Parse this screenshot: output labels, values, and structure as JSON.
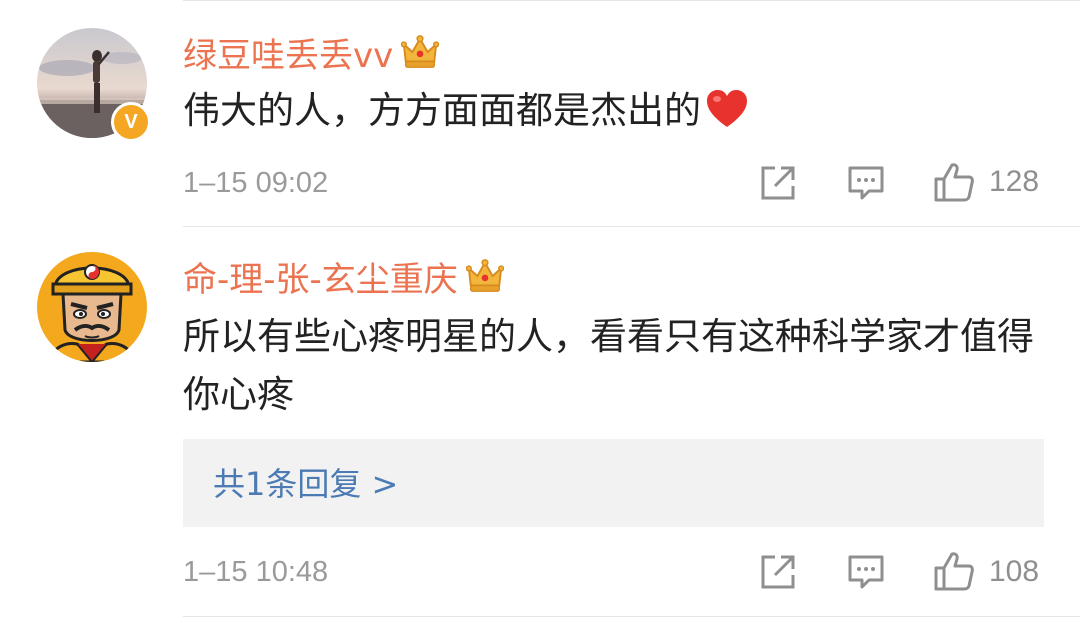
{
  "comments": [
    {
      "username": "绿豆哇丢丢vv",
      "verified_badge": "V",
      "text": "伟大的人，方方面面都是杰出的",
      "emoji": "heart-icon",
      "timestamp": "1–15 09:02",
      "likes": "128"
    },
    {
      "username": "命-理-张-玄尘重庆",
      "text": "所以有些心疼明星的人，看看只有这种科学家才值得你心疼",
      "reply_link": "共1条回复 >",
      "timestamp": "1–15 10:48",
      "likes": "108"
    }
  ],
  "colors": {
    "username": "#eb7350",
    "reply_link": "#4c7bb3",
    "verified": "#f5a623",
    "heart": "#e8322e"
  },
  "icons": [
    "crown-icon",
    "share-icon",
    "comment-icon",
    "thumb-up-icon",
    "heart-icon"
  ]
}
